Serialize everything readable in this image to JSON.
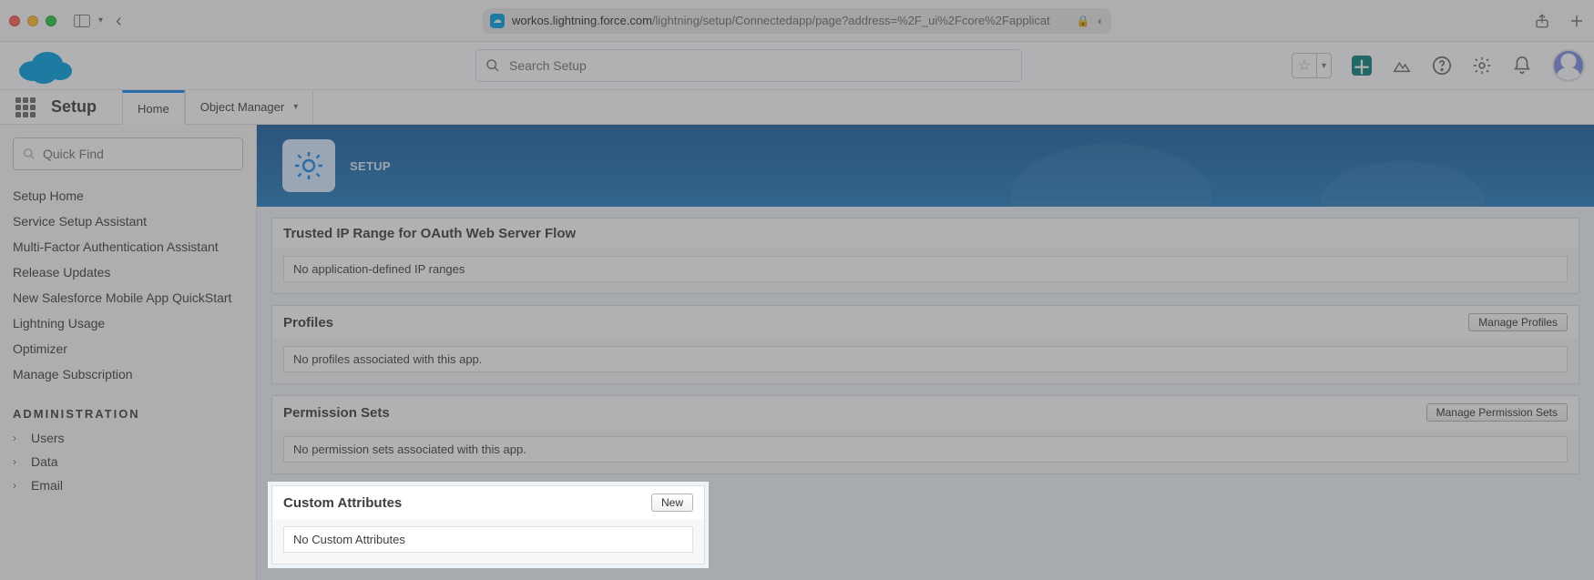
{
  "browser": {
    "url_domain": "workos.lightning.force.com",
    "url_path": "/lightning/setup/Connectedapp/page?address=%2F_ui%2Fcore%2Fapplicat"
  },
  "header": {
    "search_placeholder": "Search Setup"
  },
  "nav": {
    "app_title": "Setup",
    "tabs": [
      {
        "label": "Home"
      },
      {
        "label": "Object Manager"
      }
    ]
  },
  "sidebar": {
    "quick_find_placeholder": "Quick Find",
    "links": [
      "Setup Home",
      "Service Setup Assistant",
      "Multi-Factor Authentication Assistant",
      "Release Updates",
      "New Salesforce Mobile App QuickStart",
      "Lightning Usage",
      "Optimizer",
      "Manage Subscription"
    ],
    "section_label": "ADMINISTRATION",
    "tree": [
      "Users",
      "Data",
      "Email"
    ]
  },
  "banner": {
    "eyebrow": "SETUP"
  },
  "sections": {
    "trusted_ip": {
      "title": "Trusted IP Range for OAuth Web Server Flow",
      "empty": "No application-defined IP ranges"
    },
    "profiles": {
      "title": "Profiles",
      "button": "Manage Profiles",
      "empty": "No profiles associated with this app."
    },
    "perm_sets": {
      "title": "Permission Sets",
      "button": "Manage Permission Sets",
      "empty": "No permission sets associated with this app."
    },
    "custom_attrs": {
      "title": "Custom Attributes",
      "button": "New",
      "empty": "No Custom Attributes"
    }
  }
}
